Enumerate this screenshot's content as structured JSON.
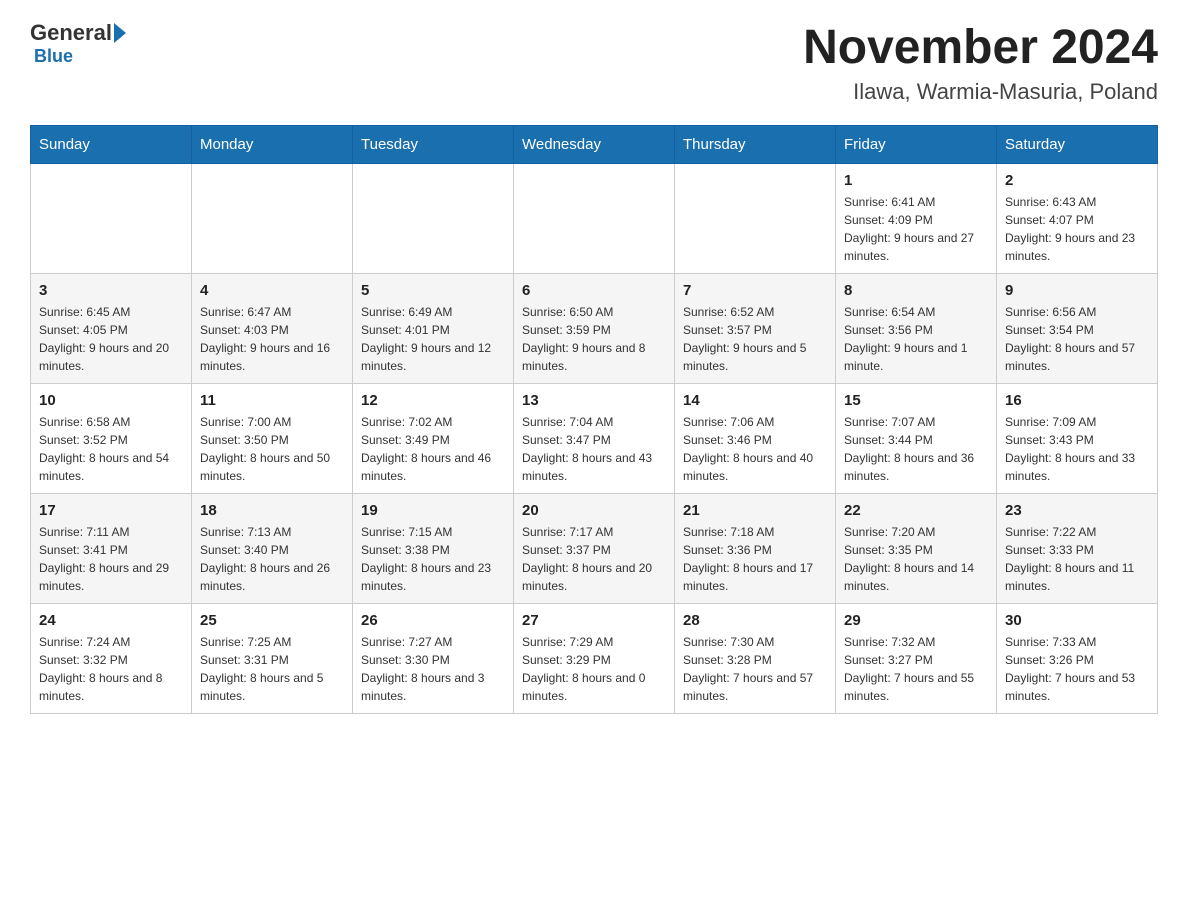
{
  "header": {
    "logo_general": "General",
    "logo_blue": "Blue",
    "title": "November 2024",
    "location": "Ilawa, Warmia-Masuria, Poland"
  },
  "days_of_week": [
    "Sunday",
    "Monday",
    "Tuesday",
    "Wednesday",
    "Thursday",
    "Friday",
    "Saturday"
  ],
  "weeks": [
    {
      "days": [
        {
          "number": "",
          "info": ""
        },
        {
          "number": "",
          "info": ""
        },
        {
          "number": "",
          "info": ""
        },
        {
          "number": "",
          "info": ""
        },
        {
          "number": "",
          "info": ""
        },
        {
          "number": "1",
          "info": "Sunrise: 6:41 AM\nSunset: 4:09 PM\nDaylight: 9 hours and 27 minutes."
        },
        {
          "number": "2",
          "info": "Sunrise: 6:43 AM\nSunset: 4:07 PM\nDaylight: 9 hours and 23 minutes."
        }
      ]
    },
    {
      "days": [
        {
          "number": "3",
          "info": "Sunrise: 6:45 AM\nSunset: 4:05 PM\nDaylight: 9 hours and 20 minutes."
        },
        {
          "number": "4",
          "info": "Sunrise: 6:47 AM\nSunset: 4:03 PM\nDaylight: 9 hours and 16 minutes."
        },
        {
          "number": "5",
          "info": "Sunrise: 6:49 AM\nSunset: 4:01 PM\nDaylight: 9 hours and 12 minutes."
        },
        {
          "number": "6",
          "info": "Sunrise: 6:50 AM\nSunset: 3:59 PM\nDaylight: 9 hours and 8 minutes."
        },
        {
          "number": "7",
          "info": "Sunrise: 6:52 AM\nSunset: 3:57 PM\nDaylight: 9 hours and 5 minutes."
        },
        {
          "number": "8",
          "info": "Sunrise: 6:54 AM\nSunset: 3:56 PM\nDaylight: 9 hours and 1 minute."
        },
        {
          "number": "9",
          "info": "Sunrise: 6:56 AM\nSunset: 3:54 PM\nDaylight: 8 hours and 57 minutes."
        }
      ]
    },
    {
      "days": [
        {
          "number": "10",
          "info": "Sunrise: 6:58 AM\nSunset: 3:52 PM\nDaylight: 8 hours and 54 minutes."
        },
        {
          "number": "11",
          "info": "Sunrise: 7:00 AM\nSunset: 3:50 PM\nDaylight: 8 hours and 50 minutes."
        },
        {
          "number": "12",
          "info": "Sunrise: 7:02 AM\nSunset: 3:49 PM\nDaylight: 8 hours and 46 minutes."
        },
        {
          "number": "13",
          "info": "Sunrise: 7:04 AM\nSunset: 3:47 PM\nDaylight: 8 hours and 43 minutes."
        },
        {
          "number": "14",
          "info": "Sunrise: 7:06 AM\nSunset: 3:46 PM\nDaylight: 8 hours and 40 minutes."
        },
        {
          "number": "15",
          "info": "Sunrise: 7:07 AM\nSunset: 3:44 PM\nDaylight: 8 hours and 36 minutes."
        },
        {
          "number": "16",
          "info": "Sunrise: 7:09 AM\nSunset: 3:43 PM\nDaylight: 8 hours and 33 minutes."
        }
      ]
    },
    {
      "days": [
        {
          "number": "17",
          "info": "Sunrise: 7:11 AM\nSunset: 3:41 PM\nDaylight: 8 hours and 29 minutes."
        },
        {
          "number": "18",
          "info": "Sunrise: 7:13 AM\nSunset: 3:40 PM\nDaylight: 8 hours and 26 minutes."
        },
        {
          "number": "19",
          "info": "Sunrise: 7:15 AM\nSunset: 3:38 PM\nDaylight: 8 hours and 23 minutes."
        },
        {
          "number": "20",
          "info": "Sunrise: 7:17 AM\nSunset: 3:37 PM\nDaylight: 8 hours and 20 minutes."
        },
        {
          "number": "21",
          "info": "Sunrise: 7:18 AM\nSunset: 3:36 PM\nDaylight: 8 hours and 17 minutes."
        },
        {
          "number": "22",
          "info": "Sunrise: 7:20 AM\nSunset: 3:35 PM\nDaylight: 8 hours and 14 minutes."
        },
        {
          "number": "23",
          "info": "Sunrise: 7:22 AM\nSunset: 3:33 PM\nDaylight: 8 hours and 11 minutes."
        }
      ]
    },
    {
      "days": [
        {
          "number": "24",
          "info": "Sunrise: 7:24 AM\nSunset: 3:32 PM\nDaylight: 8 hours and 8 minutes."
        },
        {
          "number": "25",
          "info": "Sunrise: 7:25 AM\nSunset: 3:31 PM\nDaylight: 8 hours and 5 minutes."
        },
        {
          "number": "26",
          "info": "Sunrise: 7:27 AM\nSunset: 3:30 PM\nDaylight: 8 hours and 3 minutes."
        },
        {
          "number": "27",
          "info": "Sunrise: 7:29 AM\nSunset: 3:29 PM\nDaylight: 8 hours and 0 minutes."
        },
        {
          "number": "28",
          "info": "Sunrise: 7:30 AM\nSunset: 3:28 PM\nDaylight: 7 hours and 57 minutes."
        },
        {
          "number": "29",
          "info": "Sunrise: 7:32 AM\nSunset: 3:27 PM\nDaylight: 7 hours and 55 minutes."
        },
        {
          "number": "30",
          "info": "Sunrise: 7:33 AM\nSunset: 3:26 PM\nDaylight: 7 hours and 53 minutes."
        }
      ]
    }
  ]
}
